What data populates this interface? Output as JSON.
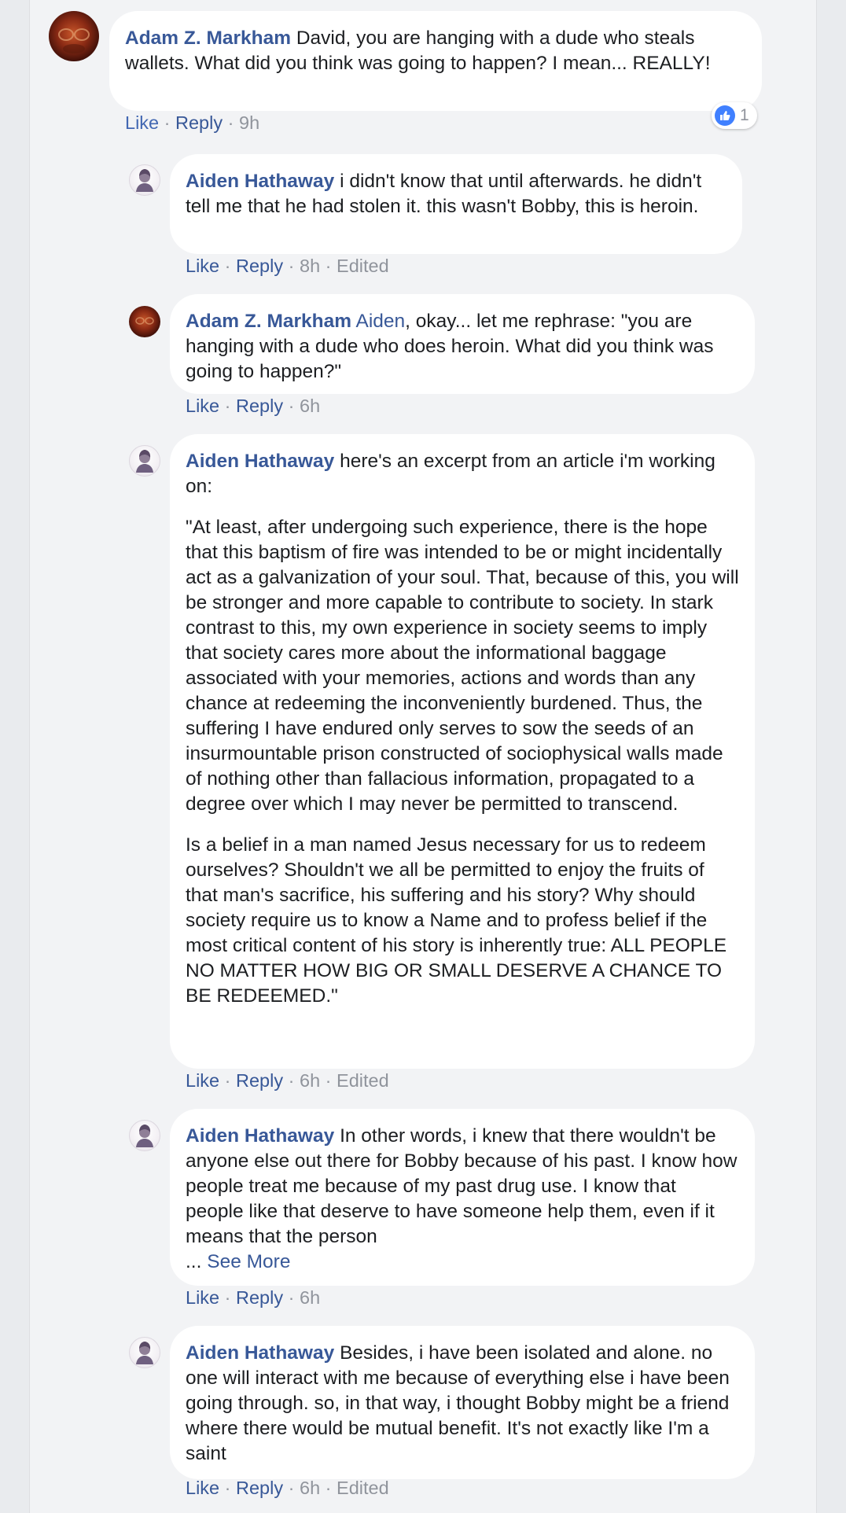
{
  "comments": [
    {
      "author": "Adam Z. Markham",
      "text": "David, you are hanging with a dude who steals wallets. What did you think was going to happen? I mean... REALLY!",
      "like_label": "Like",
      "reply_label": "Reply",
      "time": "9h",
      "reaction_count": "1",
      "reaction_icon": "thumbs-up-icon"
    }
  ],
  "replies": [
    {
      "author": "Aiden Hathaway",
      "text": "i didn't know that until afterwards. he didn't tell me that he had stolen it. this wasn't Bobby, this is heroin.",
      "like_label": "Like",
      "reply_label": "Reply",
      "time": "8h",
      "edited": "Edited"
    },
    {
      "author": "Adam Z. Markham",
      "mention": "Aiden",
      "text": ", okay... let me rephrase: \"you are hanging with a dude who does heroin. What did you think was going to happen?\"",
      "like_label": "Like",
      "reply_label": "Reply",
      "time": "6h"
    },
    {
      "author": "Aiden Hathaway",
      "text": "here's an excerpt from an article i'm working on:",
      "paragraph_2": "\"At least, after undergoing such experience, there is the hope that this baptism of fire was intended to be or might incidentally act as a galvanization of your soul. That, because of this, you will be stronger and more capable to contribute to society. In stark contrast to this, my own experience in society seems to imply that society cares more about the informational baggage associated with your memories, actions and words than any chance at redeeming the inconveniently burdened. Thus, the suffering I have endured only serves to sow the seeds of an insurmountable prison constructed of sociophysical walls made of nothing other than fallacious information, propagated to a degree over which I may never be permitted to transcend.",
      "paragraph_3": "Is a belief in a man named Jesus necessary for us to redeem ourselves? Shouldn't we all be permitted to enjoy the fruits of that man's sacrifice, his suffering and his story? Why should society require us to know a Name and to profess belief if the most critical content of his story is inherently true: ALL PEOPLE NO MATTER HOW BIG OR SMALL DESERVE A CHANCE TO BE REDEEMED.\"",
      "like_label": "Like",
      "reply_label": "Reply",
      "time": "6h",
      "edited": "Edited"
    },
    {
      "author": "Aiden Hathaway",
      "text": "In other words, i knew that there wouldn't be anyone else out there for Bobby because of his past. I know how people treat me because of my past drug use. I know that people like that deserve to have someone help them, even if it means that the person",
      "ellipsis": "...",
      "see_more": "See More",
      "like_label": "Like",
      "reply_label": "Reply",
      "time": "6h"
    },
    {
      "author": "Aiden Hathaway",
      "text": "Besides, i have been isolated and alone. no one will interact with me because of everything else i have been going through. so, in that way, i thought Bobby might be a friend where there would be mutual benefit. It's not exactly like I'm a saint",
      "like_label": "Like",
      "reply_label": "Reply",
      "time": "6h",
      "edited": "Edited"
    }
  ],
  "separator": "·",
  "colors": {
    "name_link": "#385898",
    "like_active": "#4267b2",
    "meta_gray": "#90949c",
    "bubble_bg": "#ffffff",
    "page_bg": "#f2f3f5"
  }
}
